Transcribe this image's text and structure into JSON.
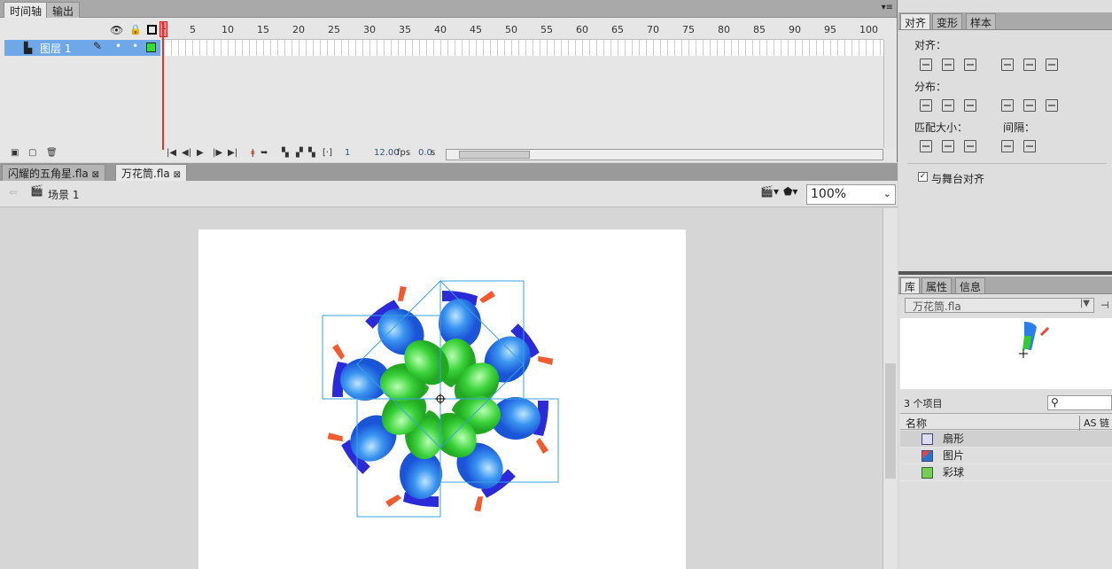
{
  "timeline": {
    "tabs": [
      "时间轴",
      "输出"
    ],
    "ruler": [
      "1",
      "5",
      "10",
      "15",
      "20",
      "25",
      "30",
      "35",
      "40",
      "45",
      "50",
      "55",
      "60",
      "65",
      "70",
      "75",
      "80",
      "85",
      "90",
      "95",
      "100"
    ],
    "layer": {
      "name": "图层 1"
    },
    "current_frame": "1",
    "fps": "12.00",
    "fps_unit": "fps",
    "time": "0.0",
    "time_unit": "s"
  },
  "documents": [
    {
      "name": "闪耀的五角星.fla"
    },
    {
      "name": "万花筒.fla"
    }
  ],
  "scene": {
    "name": "场景 1",
    "zoom": "100%"
  },
  "align_panel": {
    "tabs": [
      "对齐",
      "变形",
      "样本"
    ],
    "align_label": "对齐：",
    "distribute_label": "分布：",
    "match_size_label": "匹配大小：",
    "spacing_label": "间隔：",
    "stage_align_label": "与舞台对齐",
    "stage_align_checked": true
  },
  "library_panel": {
    "tabs": [
      "库",
      "属性",
      "信息"
    ],
    "document": "万花筒.fla",
    "item_count": "3 个项目",
    "columns": [
      "名称",
      "AS 链接"
    ],
    "items": [
      {
        "name": "扇形",
        "type": "graphic"
      },
      {
        "name": "图片",
        "type": "bitmap"
      },
      {
        "name": "彩球",
        "type": "movieclip"
      }
    ],
    "search_placeholder": ""
  },
  "colors": {
    "selection": "#6fa8e8",
    "playhead": "#dd3333",
    "outline": "#3aa0e0"
  }
}
